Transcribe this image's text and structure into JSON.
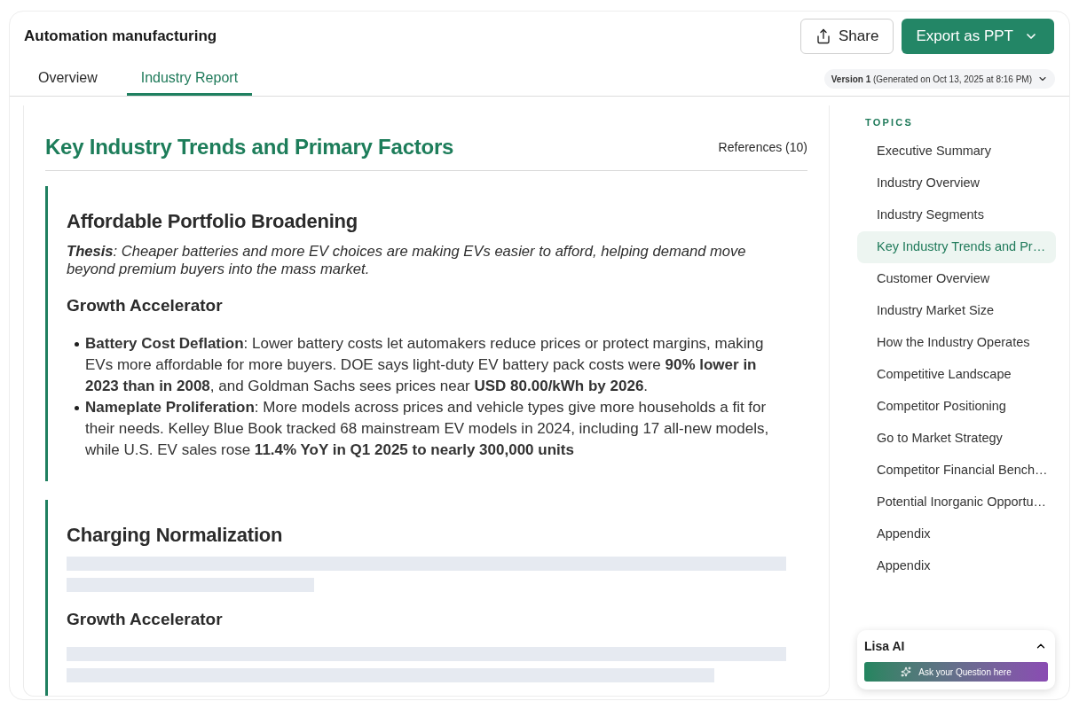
{
  "header": {
    "title": "Automation manufacturing",
    "share_button": "Share",
    "export_button": "Export as PPT"
  },
  "tabs": [
    {
      "label": "Overview",
      "selected": false
    },
    {
      "label": "Industry Report",
      "selected": true
    }
  ],
  "version": "**Version 1** (Generated on Oct 13, 2025 at 8:16 PM)",
  "report": {
    "title": "Key Industry Trends and Primary Factors",
    "references": "References (10)",
    "sections": [
      {
        "title": "Affordable Portfolio Broadening",
        "loading": false,
        "thesis": "**Thesis**: Cheaper batteries and more EV choices are making EVs easier to afford, helping demand move beyond premium buyers into the mass market.",
        "subheading": "Growth Accelerator",
        "bullets": [
          "**Battery Cost Deflation**: Lower battery costs let automakers reduce prices or protect margins, making EVs more affordable for more buyers. DOE says light-duty EV battery pack costs were **90% lower in 2023 than in 2008**, and Goldman Sachs sees prices near **USD 80.00/kWh by 2026**.",
          "**Nameplate Proliferation**: More models across prices and vehicle types give more households a fit for their needs. Kelley Blue Book tracked 68 mainstream EV models in 2024, including 17 all-new models, while U.S. EV sales rose **11.4% YoY in Q1 2025 to nearly 300,000 units**"
        ]
      },
      {
        "title": "Charging Normalization",
        "loading": true,
        "subheading": "Growth Accelerator"
      }
    ]
  },
  "topics": {
    "heading": "TOPICS",
    "items": [
      {
        "label": "Executive Summary",
        "selected": false
      },
      {
        "label": "Industry Overview",
        "selected": false
      },
      {
        "label": "Industry Segments",
        "selected": false
      },
      {
        "label": "Key Industry Trends and Pr…",
        "selected": true
      },
      {
        "label": "Customer Overview",
        "selected": false
      },
      {
        "label": "Industry Market Size",
        "selected": false
      },
      {
        "label": "How the Industry Operates",
        "selected": false
      },
      {
        "label": "Competitive Landscape",
        "selected": false
      },
      {
        "label": "Competitor Positioning",
        "selected": false
      },
      {
        "label": "Go to Market Strategy",
        "selected": false
      },
      {
        "label": "Competitor Financial Bench…",
        "selected": false
      },
      {
        "label": "Potential Inorganic Opportu…",
        "selected": false
      },
      {
        "label": "Appendix",
        "selected": false
      },
      {
        "label": "Appendix",
        "selected": false
      }
    ]
  },
  "assistant": {
    "title": "Lisa AI",
    "button": "Ask your Question here"
  }
}
